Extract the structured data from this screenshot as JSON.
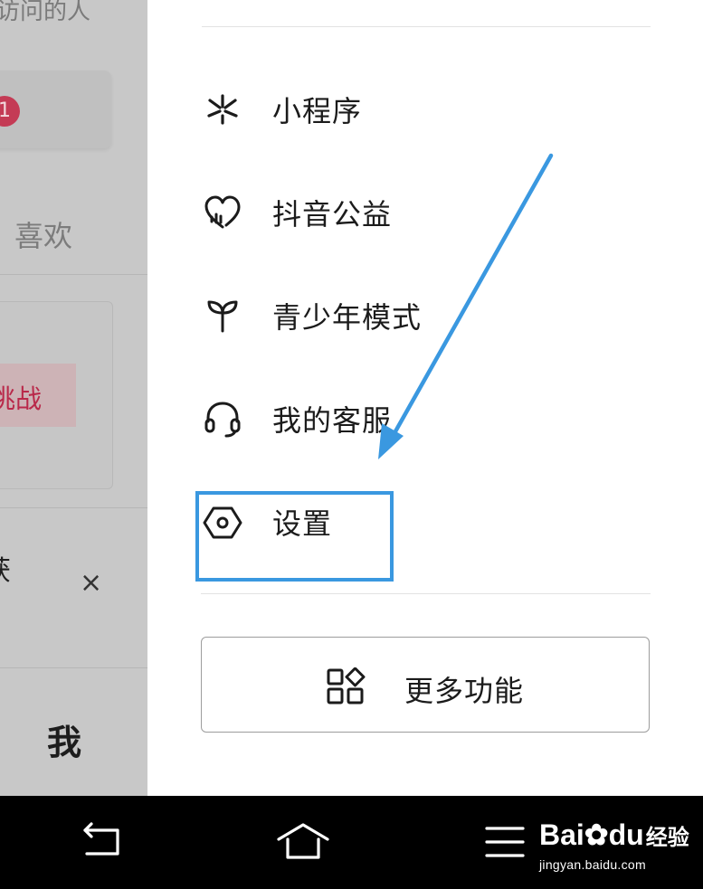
{
  "left_pane": {
    "top_text": "访问的人",
    "badge": "1",
    "like_tab": "喜欢",
    "challenge": "挑战",
    "partial_char": "获",
    "close_symbol": "×",
    "me_tab": "我"
  },
  "menu": {
    "items": [
      {
        "label": "小程序",
        "icon": "mini-program-icon"
      },
      {
        "label": "抖音公益",
        "icon": "charity-heart-icon"
      },
      {
        "label": "青少年模式",
        "icon": "sprout-icon"
      },
      {
        "label": "我的客服",
        "icon": "headset-icon"
      },
      {
        "label": "设置",
        "icon": "settings-hexagon-icon"
      }
    ],
    "more_button": {
      "label": "更多功能",
      "icon": "apps-grid-icon"
    }
  },
  "annotation": {
    "color": "#3a98e0"
  },
  "nav": {
    "back_icon": "back-icon",
    "home_icon": "home-icon",
    "menu_icon": "menu-lines-icon"
  },
  "watermark": {
    "brand": "Bai",
    "brand_mid": "du",
    "brand_suffix": "经验",
    "url": "jingyan.baidu.com"
  }
}
